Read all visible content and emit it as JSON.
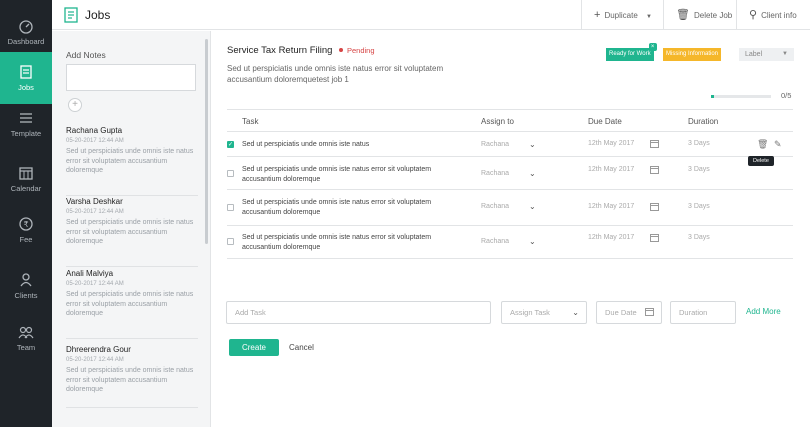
{
  "nav": {
    "items": [
      {
        "label": "Dashboard",
        "icon": "dashboard-icon"
      },
      {
        "label": "Jobs",
        "icon": "jobs-icon",
        "active": true
      },
      {
        "label": "Template",
        "icon": "template-icon"
      },
      {
        "label": "Calendar",
        "icon": "calendar-icon"
      },
      {
        "label": "Fee",
        "icon": "fee-icon"
      },
      {
        "label": "Clients",
        "icon": "clients-icon"
      },
      {
        "label": "Team",
        "icon": "team-icon"
      }
    ]
  },
  "topbar": {
    "title": "Jobs",
    "duplicate": "Duplicate",
    "delete_job": "Delete Job",
    "client_info": "Client info"
  },
  "notes": {
    "header": "Add Notes",
    "items": [
      {
        "name": "Rachana Gupta",
        "date": "05-20-2017 12:44 AM",
        "text": "Sed ut perspiciatis unde omnis iste natus error sit voluptatem accusantium doloremque"
      },
      {
        "name": "Varsha Deshkar",
        "date": "05-20-2017 12:44 AM",
        "text": "Sed ut perspiciatis unde omnis iste natus error sit voluptatem accusantium doloremque"
      },
      {
        "name": "Anali Malviya",
        "date": "05-20-2017 12:44 AM",
        "text": "Sed ut perspiciatis unde omnis iste natus error sit voluptatem accusantium doloremque"
      },
      {
        "name": "Dhreerendra Gour",
        "date": "05-20-2017 12:44 AM",
        "text": "Sed ut perspiciatis unde omnis iste natus error sit voluptatem accusantium doloremque"
      }
    ]
  },
  "job": {
    "title": "Service Tax Return Filing",
    "status": "Pending",
    "description": "Sed ut perspiciatis unde omnis iste natus error sit voluptatem accusantium doloremquetest job 1",
    "tags": {
      "ready": "Ready for Work",
      "missing": "Missing Information"
    },
    "label_select": "Label",
    "progress_text": "0/5",
    "progress_fraction": 0.05
  },
  "table": {
    "headers": {
      "task": "Task",
      "assign": "Assign to",
      "due": "Due Date",
      "duration": "Duration"
    },
    "rows": [
      {
        "task": "Sed ut perspiciatis unde omnis iste natus",
        "assign": "Rachana",
        "due": "12th May 2017",
        "duration": "3 Days",
        "checked": true
      },
      {
        "task": "Sed ut perspiciatis unde omnis iste natus error sit voluptatem accusantium doloremque",
        "assign": "Rachana",
        "due": "12th May 2017",
        "duration": "3 Days",
        "checked": false
      },
      {
        "task": "Sed ut perspiciatis unde omnis iste natus error sit voluptatem accusantium doloremque",
        "assign": "Rachana",
        "due": "12th May 2017",
        "duration": "3 Days",
        "checked": false
      },
      {
        "task": "Sed ut perspiciatis unde omnis iste natus error sit voluptatem accusantium doloremque",
        "assign": "Rachana",
        "due": "12th May 2017",
        "duration": "3 Days",
        "checked": false
      }
    ],
    "tooltip": "Delete"
  },
  "add_task": {
    "task_placeholder": "Add Task",
    "assign_placeholder": "Assign Task",
    "due_placeholder": "Due Date",
    "duration_placeholder": "Duration",
    "add_more": "Add More",
    "create": "Create",
    "cancel": "Cancel"
  },
  "colors": {
    "accent": "#1fb58f",
    "nav_bg": "#1f2429",
    "pending": "#d64545",
    "warning": "#f5b72a"
  }
}
